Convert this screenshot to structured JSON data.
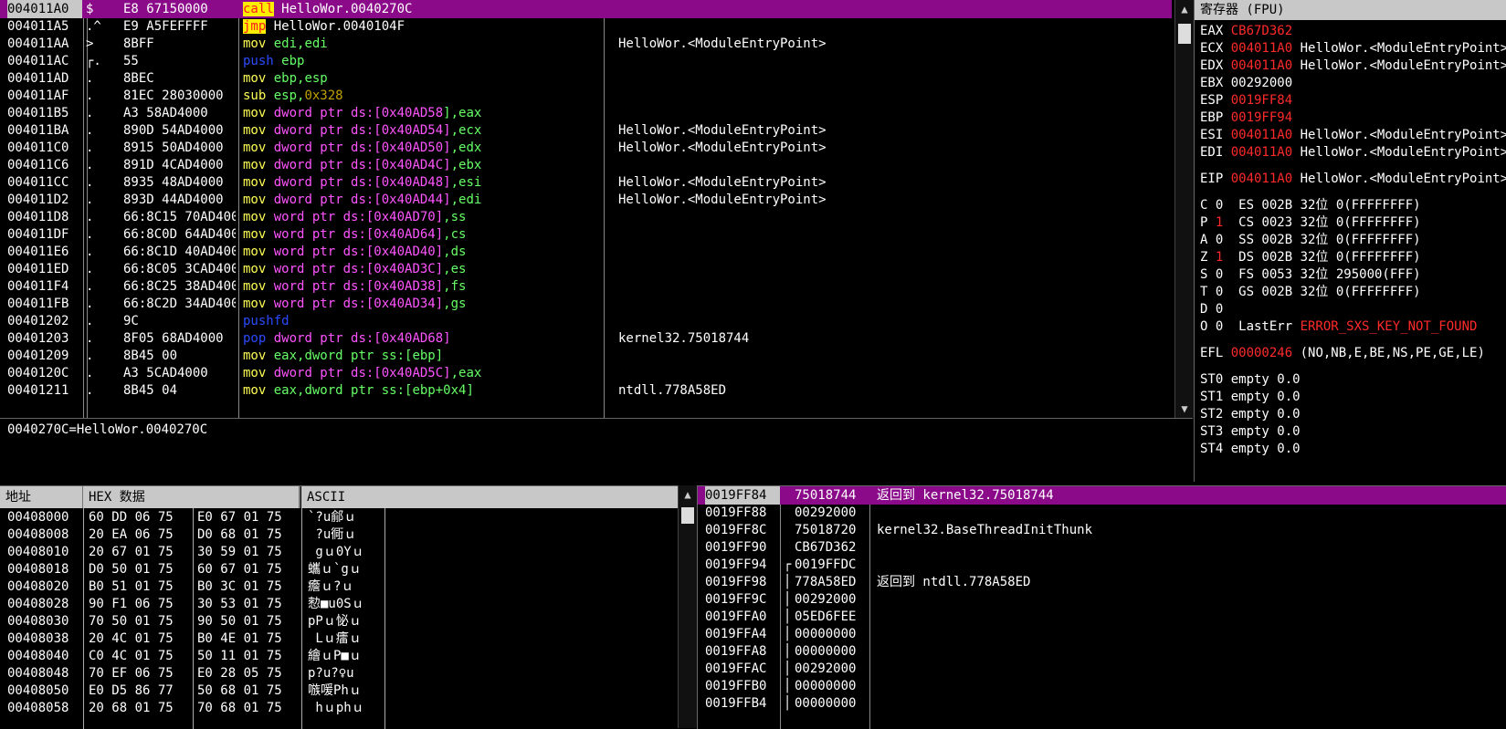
{
  "colors": {
    "selection": "#8a0a8a",
    "header_bg": "#c8c8c8",
    "accent_red": "#ff2a2a"
  },
  "disasm": {
    "rows": [
      {
        "addr": "004011A0",
        "mark": "$",
        "bytes": "E8 67150000",
        "instr": [
          {
            "t": "call",
            "c": "#ff1e1e",
            "bg": "#ffee00"
          },
          {
            "t": " HelloWor.0040270C",
            "c": "#ffffff"
          }
        ],
        "cmt": "",
        "sel": true
      },
      {
        "addr": "004011A5",
        "mark": ".^",
        "bytes": "E9 A5FEFFFF",
        "instr": [
          {
            "t": "jmp",
            "c": "#ff1e1e",
            "bg": "#ffee00"
          },
          {
            "t": " HelloWor.0040104F",
            "c": "#ffffff"
          }
        ],
        "cmt": ""
      },
      {
        "addr": "004011AA",
        "mark": ">",
        "bytes": "8BFF",
        "instr": [
          {
            "t": "mov",
            "c": "#ffff55"
          },
          {
            "t": " edi,edi",
            "c": "#66ff66"
          }
        ],
        "cmt": "HelloWor.<ModuleEntryPoint>"
      },
      {
        "addr": "004011AC",
        "mark": "┌.",
        "bytes": "55",
        "instr": [
          {
            "t": "push",
            "c": "#2a4bff"
          },
          {
            "t": " ebp",
            "c": "#66ff66"
          }
        ],
        "cmt": ""
      },
      {
        "addr": "004011AD",
        "mark": ".",
        "bytes": "8BEC",
        "instr": [
          {
            "t": "mov",
            "c": "#ffff55"
          },
          {
            "t": " ebp,esp",
            "c": "#66ff66"
          }
        ],
        "cmt": ""
      },
      {
        "addr": "004011AF",
        "mark": ".",
        "bytes": "81EC 28030000",
        "instr": [
          {
            "t": "sub",
            "c": "#ffff55"
          },
          {
            "t": " esp,",
            "c": "#66ff66"
          },
          {
            "t": "0x328",
            "c": "#c0a000"
          }
        ],
        "cmt": ""
      },
      {
        "addr": "004011B5",
        "mark": ".",
        "bytes": "A3 58AD4000",
        "instr": [
          {
            "t": "mov",
            "c": "#ffff55"
          },
          {
            "t": " dword ptr ds:[",
            "c": "#ff55ff"
          },
          {
            "t": "0x40AD58",
            "c": "#ff55ff"
          },
          {
            "t": "],eax",
            "c": "#66ff66"
          }
        ],
        "cmt": ""
      },
      {
        "addr": "004011BA",
        "mark": ".",
        "bytes": "890D 54AD4000",
        "instr": [
          {
            "t": "mov",
            "c": "#ffff55"
          },
          {
            "t": " dword ptr ds:[0x40AD54]",
            "c": "#ff55ff"
          },
          {
            "t": ",ecx",
            "c": "#66ff66"
          }
        ],
        "cmt": "HelloWor.<ModuleEntryPoint>"
      },
      {
        "addr": "004011C0",
        "mark": ".",
        "bytes": "8915 50AD4000",
        "instr": [
          {
            "t": "mov",
            "c": "#ffff55"
          },
          {
            "t": " dword ptr ds:[0x40AD50]",
            "c": "#ff55ff"
          },
          {
            "t": ",edx",
            "c": "#66ff66"
          }
        ],
        "cmt": "HelloWor.<ModuleEntryPoint>"
      },
      {
        "addr": "004011C6",
        "mark": ".",
        "bytes": "891D 4CAD4000",
        "instr": [
          {
            "t": "mov",
            "c": "#ffff55"
          },
          {
            "t": " dword ptr ds:[0x40AD4C]",
            "c": "#ff55ff"
          },
          {
            "t": ",ebx",
            "c": "#66ff66"
          }
        ],
        "cmt": ""
      },
      {
        "addr": "004011CC",
        "mark": ".",
        "bytes": "8935 48AD4000",
        "instr": [
          {
            "t": "mov",
            "c": "#ffff55"
          },
          {
            "t": " dword ptr ds:[0x40AD48]",
            "c": "#ff55ff"
          },
          {
            "t": ",esi",
            "c": "#66ff66"
          }
        ],
        "cmt": "HelloWor.<ModuleEntryPoint>"
      },
      {
        "addr": "004011D2",
        "mark": ".",
        "bytes": "893D 44AD4000",
        "instr": [
          {
            "t": "mov",
            "c": "#ffff55"
          },
          {
            "t": " dword ptr ds:[0x40AD44]",
            "c": "#ff55ff"
          },
          {
            "t": ",edi",
            "c": "#66ff66"
          }
        ],
        "cmt": "HelloWor.<ModuleEntryPoint>"
      },
      {
        "addr": "004011D8",
        "mark": ".",
        "bytes": "66:8C15 70AD4000",
        "instr": [
          {
            "t": "mov",
            "c": "#ffff55"
          },
          {
            "t": " word ptr ds:[0x40AD70]",
            "c": "#ff55ff"
          },
          {
            "t": ",ss",
            "c": "#66ff66"
          }
        ],
        "cmt": ""
      },
      {
        "addr": "004011DF",
        "mark": ".",
        "bytes": "66:8C0D 64AD4000",
        "instr": [
          {
            "t": "mov",
            "c": "#ffff55"
          },
          {
            "t": " word ptr ds:[0x40AD64]",
            "c": "#ff55ff"
          },
          {
            "t": ",cs",
            "c": "#66ff66"
          }
        ],
        "cmt": ""
      },
      {
        "addr": "004011E6",
        "mark": ".",
        "bytes": "66:8C1D 40AD4000",
        "instr": [
          {
            "t": "mov",
            "c": "#ffff55"
          },
          {
            "t": " word ptr ds:[0x40AD40]",
            "c": "#ff55ff"
          },
          {
            "t": ",ds",
            "c": "#66ff66"
          }
        ],
        "cmt": ""
      },
      {
        "addr": "004011ED",
        "mark": ".",
        "bytes": "66:8C05 3CAD4000",
        "instr": [
          {
            "t": "mov",
            "c": "#ffff55"
          },
          {
            "t": " word ptr ds:[0x40AD3C]",
            "c": "#ff55ff"
          },
          {
            "t": ",es",
            "c": "#66ff66"
          }
        ],
        "cmt": ""
      },
      {
        "addr": "004011F4",
        "mark": ".",
        "bytes": "66:8C25 38AD4000",
        "instr": [
          {
            "t": "mov",
            "c": "#ffff55"
          },
          {
            "t": " word ptr ds:[0x40AD38]",
            "c": "#ff55ff"
          },
          {
            "t": ",fs",
            "c": "#66ff66"
          }
        ],
        "cmt": ""
      },
      {
        "addr": "004011FB",
        "mark": ".",
        "bytes": "66:8C2D 34AD4000",
        "instr": [
          {
            "t": "mov",
            "c": "#ffff55"
          },
          {
            "t": " word ptr ds:[0x40AD34]",
            "c": "#ff55ff"
          },
          {
            "t": ",gs",
            "c": "#66ff66"
          }
        ],
        "cmt": ""
      },
      {
        "addr": "00401202",
        "mark": ".",
        "bytes": "9C",
        "instr": [
          {
            "t": "pushfd",
            "c": "#2a4bff"
          }
        ],
        "cmt": ""
      },
      {
        "addr": "00401203",
        "mark": ".",
        "bytes": "8F05 68AD4000",
        "instr": [
          {
            "t": "pop",
            "c": "#2a4bff"
          },
          {
            "t": " dword ptr ds:[0x40AD68]",
            "c": "#ff55ff"
          }
        ],
        "cmt": "kernel32.75018744"
      },
      {
        "addr": "00401209",
        "mark": ".",
        "bytes": "8B45 00",
        "instr": [
          {
            "t": "mov",
            "c": "#ffff55"
          },
          {
            "t": " eax,dword ptr ss:[ebp]",
            "c": "#66ff66"
          }
        ],
        "cmt": ""
      },
      {
        "addr": "0040120C",
        "mark": ".",
        "bytes": "A3 5CAD4000",
        "instr": [
          {
            "t": "mov",
            "c": "#ffff55"
          },
          {
            "t": " dword ptr ds:[0x40AD5C]",
            "c": "#ff55ff"
          },
          {
            "t": ",eax",
            "c": "#66ff66"
          }
        ],
        "cmt": ""
      },
      {
        "addr": "00401211",
        "mark": ".",
        "bytes": "8B45 04",
        "instr": [
          {
            "t": "mov",
            "c": "#ffff55"
          },
          {
            "t": " eax,dword ptr ss:[ebp+0x4]",
            "c": "#66ff66"
          }
        ],
        "cmt": "ntdll.778A58ED"
      }
    ]
  },
  "info_line": "0040270C=HelloWor.0040270C",
  "registers": {
    "title": "寄存器 (FPU)",
    "rows": [
      [
        {
          "t": "EAX ",
          "c": "w"
        },
        {
          "t": "CB67D362",
          "c": "r"
        }
      ],
      [
        {
          "t": "ECX ",
          "c": "w"
        },
        {
          "t": "004011A0",
          "c": "r"
        },
        {
          "t": " HelloWor.<ModuleEntryPoint>",
          "c": "w"
        }
      ],
      [
        {
          "t": "EDX ",
          "c": "w"
        },
        {
          "t": "004011A0",
          "c": "r"
        },
        {
          "t": " HelloWor.<ModuleEntryPoint>",
          "c": "w"
        }
      ],
      [
        {
          "t": "EBX 00292000",
          "c": "w"
        }
      ],
      [
        {
          "t": "ESP ",
          "c": "w"
        },
        {
          "t": "0019FF84",
          "c": "r"
        }
      ],
      [
        {
          "t": "EBP ",
          "c": "w"
        },
        {
          "t": "0019FF94",
          "c": "r"
        }
      ],
      [
        {
          "t": "ESI ",
          "c": "w"
        },
        {
          "t": "004011A0",
          "c": "r"
        },
        {
          "t": " HelloWor.<ModuleEntryPoint>",
          "c": "w"
        }
      ],
      [
        {
          "t": "EDI ",
          "c": "w"
        },
        {
          "t": "004011A0",
          "c": "r"
        },
        {
          "t": " HelloWor.<ModuleEntryPoint>",
          "c": "w"
        }
      ],
      [],
      [
        {
          "t": "EIP ",
          "c": "w"
        },
        {
          "t": "004011A0",
          "c": "r"
        },
        {
          "t": " HelloWor.<ModuleEntryPoint>",
          "c": "w"
        }
      ],
      [],
      [
        {
          "t": "C 0  ES 002B 32位 0(FFFFFFFF)",
          "c": "w"
        }
      ],
      [
        {
          "t": "P ",
          "c": "w"
        },
        {
          "t": "1",
          "c": "r"
        },
        {
          "t": "  CS 0023 32位 0(FFFFFFFF)",
          "c": "w"
        }
      ],
      [
        {
          "t": "A 0  SS 002B 32位 0(FFFFFFFF)",
          "c": "w"
        }
      ],
      [
        {
          "t": "Z ",
          "c": "w"
        },
        {
          "t": "1",
          "c": "r"
        },
        {
          "t": "  DS 002B 32位 0(FFFFFFFF)",
          "c": "w"
        }
      ],
      [
        {
          "t": "S 0  FS 0053 32位 295000(FFF)",
          "c": "w"
        }
      ],
      [
        {
          "t": "T 0  GS 002B 32位 0(FFFFFFFF)",
          "c": "w"
        }
      ],
      [
        {
          "t": "D 0",
          "c": "w"
        }
      ],
      [
        {
          "t": "O 0  LastErr ",
          "c": "w"
        },
        {
          "t": "ERROR_SXS_KEY_NOT_FOUND",
          "c": "r"
        }
      ],
      [],
      [
        {
          "t": "EFL ",
          "c": "w"
        },
        {
          "t": "00000246",
          "c": "r"
        },
        {
          "t": " (NO,NB,E,BE,NS,PE,GE,LE)",
          "c": "w"
        }
      ],
      [],
      [
        {
          "t": "ST0 empty 0.0",
          "c": "w"
        }
      ],
      [
        {
          "t": "ST1 empty 0.0",
          "c": "w"
        }
      ],
      [
        {
          "t": "ST2 empty 0.0",
          "c": "w"
        }
      ],
      [
        {
          "t": "ST3 empty 0.0",
          "c": "w"
        }
      ],
      [
        {
          "t": "ST4 empty 0.0",
          "c": "w"
        }
      ]
    ]
  },
  "hexdump": {
    "headers": {
      "address": "地址",
      "hex": "HEX 数据",
      "ascii": "ASCII"
    },
    "rows": [
      {
        "addr": "00408000",
        "b1": "60 DD 06 75",
        "b2": "E0 67 01 75",
        "ascii": "`?u鄃ｕ"
      },
      {
        "addr": "00408008",
        "b1": "20 EA 06 75",
        "b2": "D0 68 01 75",
        "ascii": " ?u衕ｕ"
      },
      {
        "addr": "00408010",
        "b1": "20 67 01 75",
        "b2": "30 59 01 75",
        "ascii": " gｕ0Yｕ"
      },
      {
        "addr": "00408018",
        "b1": "D0 50 01 75",
        "b2": "60 67 01 75",
        "ascii": "蠵ｕ`gｕ"
      },
      {
        "addr": "00408020",
        "b1": "B0 51 01 75",
        "b2": "B0 3C 01 75",
        "ascii": "癚ｕ?ｕ"
      },
      {
        "addr": "00408028",
        "b1": "90 F1 06 75",
        "b2": "30 53 01 75",
        "ascii": "愸■u0Sｕ"
      },
      {
        "addr": "00408030",
        "b1": "70 50 01 75",
        "b2": "90 50 01 75",
        "ascii": "pPｕ怭ｕ"
      },
      {
        "addr": "00408038",
        "b1": "20 4C 01 75",
        "b2": "B0 4E 01 75",
        "ascii": " Lｕ癗ｕ"
      },
      {
        "addr": "00408040",
        "b1": "C0 4C 01 75",
        "b2": "50 11 01 75",
        "ascii": "繪ｕP■ｕ"
      },
      {
        "addr": "00408048",
        "b1": "70 EF 06 75",
        "b2": "E0 28 05 75",
        "ascii": "p?u?♀u"
      },
      {
        "addr": "00408050",
        "b1": "E0 D5 86 77",
        "b2": "50 68 01 75",
        "ascii": "嗾喛Phｕ"
      },
      {
        "addr": "00408058",
        "b1": "20 68 01 75",
        "b2": "70 68 01 75",
        "ascii": " hｕphｕ"
      }
    ]
  },
  "stack": {
    "rows": [
      {
        "addr": "0019FF84",
        "mark": "",
        "val": "75018744",
        "cmt": "返回到 kernel32.75018744",
        "sel": true
      },
      {
        "addr": "0019FF88",
        "mark": "",
        "val": "00292000",
        "cmt": ""
      },
      {
        "addr": "0019FF8C",
        "mark": "",
        "val": "75018720",
        "cmt": "kernel32.BaseThreadInitThunk"
      },
      {
        "addr": "0019FF90",
        "mark": "",
        "val": "CB67D362",
        "cmt": ""
      },
      {
        "addr": "0019FF94",
        "mark": "┌",
        "val": "0019FFDC",
        "cmt": ""
      },
      {
        "addr": "0019FF98",
        "mark": "│",
        "val": "778A58ED",
        "cmt": "返回到 ntdll.778A58ED"
      },
      {
        "addr": "0019FF9C",
        "mark": "│",
        "val": "00292000",
        "cmt": ""
      },
      {
        "addr": "0019FFA0",
        "mark": "│",
        "val": "05ED6FEE",
        "cmt": ""
      },
      {
        "addr": "0019FFA4",
        "mark": "│",
        "val": "00000000",
        "cmt": ""
      },
      {
        "addr": "0019FFA8",
        "mark": "│",
        "val": "00000000",
        "cmt": ""
      },
      {
        "addr": "0019FFAC",
        "mark": "│",
        "val": "00292000",
        "cmt": ""
      },
      {
        "addr": "0019FFB0",
        "mark": "│",
        "val": "00000000",
        "cmt": ""
      },
      {
        "addr": "0019FFB4",
        "mark": "│",
        "val": "00000000",
        "cmt": ""
      }
    ]
  }
}
